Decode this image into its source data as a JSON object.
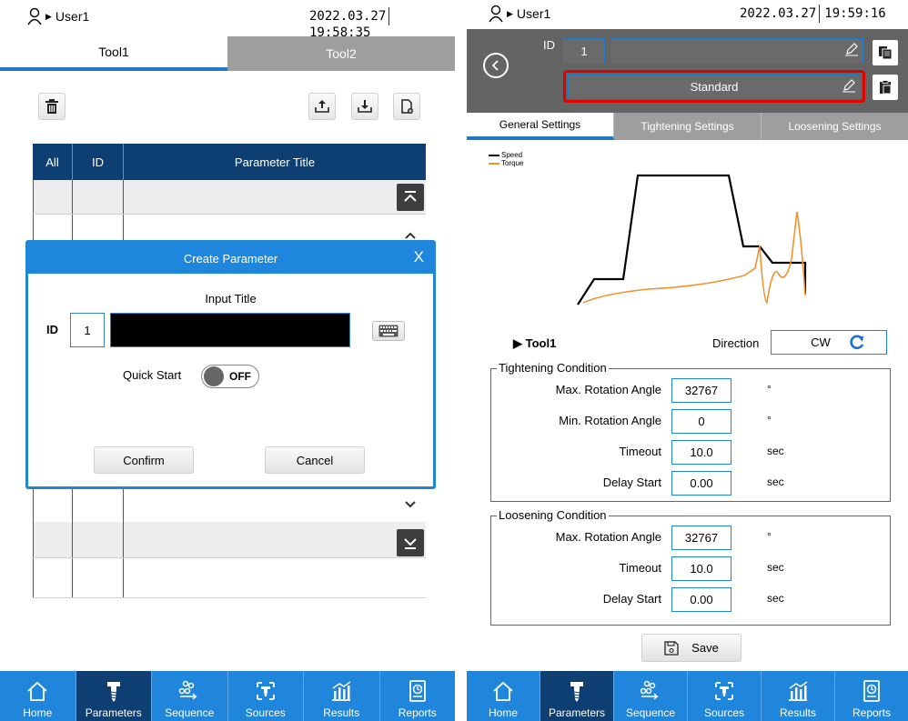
{
  "left": {
    "status": {
      "user": "User1",
      "date": "2022.03.27",
      "time": "19:58:35"
    },
    "tabs": [
      "Tool1",
      "Tool2"
    ],
    "table": {
      "headers": [
        "All",
        "ID",
        "Parameter Title"
      ]
    },
    "modal": {
      "title": "Create Parameter",
      "close": "X",
      "input_label": "Input Title",
      "id_label": "ID",
      "id_value": "1",
      "title_value": "",
      "quick_start_label": "Quick Start",
      "quick_start_state": "OFF",
      "confirm": "Confirm",
      "cancel": "Cancel"
    }
  },
  "right": {
    "status": {
      "user": "User1",
      "date": "2022.03.27",
      "time": "19:59:16"
    },
    "id_label": "ID",
    "id_value": "1",
    "name_value": "",
    "profile_value": "Standard",
    "tabs": [
      "General Settings",
      "Tightening Settings",
      "Loosening Settings"
    ],
    "legend": [
      {
        "name": "Speed",
        "color": "#000000"
      },
      {
        "name": "Torque",
        "color": "#f0922b"
      }
    ],
    "tool": "Tool1",
    "direction_label": "Direction",
    "direction_value": "CW",
    "tightening": {
      "title": "Tightening Condition",
      "rows": [
        {
          "label": "Max. Rotation Angle",
          "value": "32767",
          "unit": "°"
        },
        {
          "label": "Min. Rotation Angle",
          "value": "0",
          "unit": "°"
        },
        {
          "label": "Timeout",
          "value": "10.0",
          "unit": "sec"
        },
        {
          "label": "Delay Start",
          "value": "0.00",
          "unit": "sec"
        }
      ]
    },
    "loosening": {
      "title": "Loosening Condition",
      "rows": [
        {
          "label": "Max. Rotation Angle",
          "value": "32767",
          "unit": "°"
        },
        {
          "label": "Timeout",
          "value": "10.0",
          "unit": "sec"
        },
        {
          "label": "Delay Start",
          "value": "0.00",
          "unit": "sec"
        }
      ]
    },
    "save": "Save"
  },
  "nav": [
    "Home",
    "Parameters",
    "Sequence",
    "Sources",
    "Results",
    "Reports"
  ],
  "nav_active": "Parameters",
  "colors": {
    "accent": "#1f86dc",
    "navy": "#0d3f73",
    "highlight": "#e00000",
    "torque": "#f0922b"
  }
}
